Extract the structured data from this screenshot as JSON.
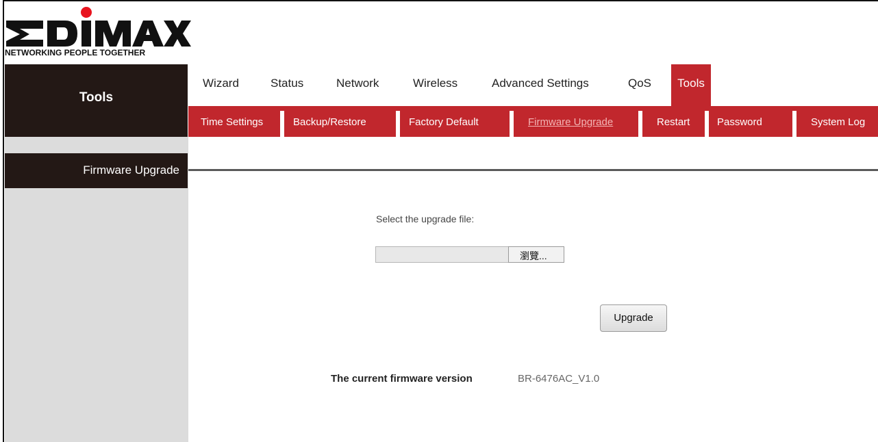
{
  "brand": {
    "name": "EDIMAX",
    "tagline": "NETWORKING PEOPLE TOGETHER",
    "dot_color": "#e8141e"
  },
  "sidebar": {
    "section_title": "Tools",
    "items": [
      {
        "label": "Firmware Upgrade",
        "active": true
      }
    ]
  },
  "main_tabs": [
    {
      "label": "Wizard"
    },
    {
      "label": "Status"
    },
    {
      "label": "Network"
    },
    {
      "label": "Wireless"
    },
    {
      "label": "Advanced Settings"
    },
    {
      "label": "QoS"
    },
    {
      "label": "Tools",
      "active": true
    }
  ],
  "sub_tabs": [
    {
      "label": "Time Settings"
    },
    {
      "label": "Backup/Restore"
    },
    {
      "label": "Factory Default"
    },
    {
      "label": "Firmware Upgrade",
      "active": true
    },
    {
      "label": "Restart"
    },
    {
      "label": "Password"
    },
    {
      "label": "System Log"
    }
  ],
  "content": {
    "select_label": "Select the upgrade file:",
    "file_value": "",
    "browse_label": "瀏覽...",
    "upgrade_label": "Upgrade",
    "firmware_label": "The current firmware version",
    "firmware_value": "BR-6476AC_V1.0"
  },
  "colors": {
    "accent": "#c1272d",
    "dark": "#231815",
    "sidebar_bg": "#dcdcdc"
  }
}
